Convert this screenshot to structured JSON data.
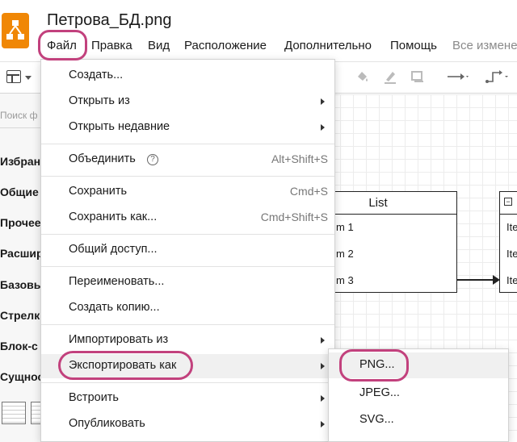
{
  "app": {
    "document_title": "Петрова_БД.png",
    "accent_color": "#c2417d",
    "logo_color": "#f08705"
  },
  "menubar": {
    "file": "Файл",
    "edit": "Правка",
    "view": "Вид",
    "arrange": "Расположение",
    "extras": "Дополнительно",
    "help": "Помощь",
    "status": "Все изменен"
  },
  "sidebar": {
    "search_placeholder": "Поиск ф",
    "sections": [
      "Избран",
      "Общие",
      "Прочее",
      "Расшир",
      "Базовы",
      "Стрелк",
      "Блок-с",
      "Сущнос"
    ]
  },
  "canvas": {
    "list_table": {
      "title": "List",
      "rows": [
        "m 1",
        "m 2",
        "m 3"
      ]
    },
    "table2": {
      "collapse_symbol": "−",
      "rows": [
        "Ite",
        "Ite",
        "Ite"
      ]
    }
  },
  "file_menu": {
    "items": [
      {
        "label": "Создать...",
        "shortcut": "",
        "submenu": false
      },
      {
        "label": "Открыть из",
        "shortcut": "",
        "submenu": true
      },
      {
        "label": "Открыть недавние",
        "shortcut": "",
        "submenu": true
      },
      {
        "label": "Объединить",
        "shortcut": "Alt+Shift+S",
        "submenu": false,
        "help": "?"
      },
      {
        "label": "Сохранить",
        "shortcut": "Cmd+S",
        "submenu": false
      },
      {
        "label": "Сохранить как...",
        "shortcut": "Cmd+Shift+S",
        "submenu": false
      },
      {
        "label": "Общий доступ...",
        "shortcut": "",
        "submenu": false
      },
      {
        "label": "Переименовать...",
        "shortcut": "",
        "submenu": false
      },
      {
        "label": "Создать копию...",
        "shortcut": "",
        "submenu": false
      },
      {
        "label": "Импортировать из",
        "shortcut": "",
        "submenu": true
      },
      {
        "label": "Экспортировать как",
        "shortcut": "",
        "submenu": true,
        "active": true
      },
      {
        "label": "Встроить",
        "shortcut": "",
        "submenu": true
      },
      {
        "label": "Опубликовать",
        "shortcut": "",
        "submenu": true
      }
    ]
  },
  "export_submenu": {
    "items": [
      "PNG...",
      "JPEG...",
      "SVG..."
    ]
  }
}
